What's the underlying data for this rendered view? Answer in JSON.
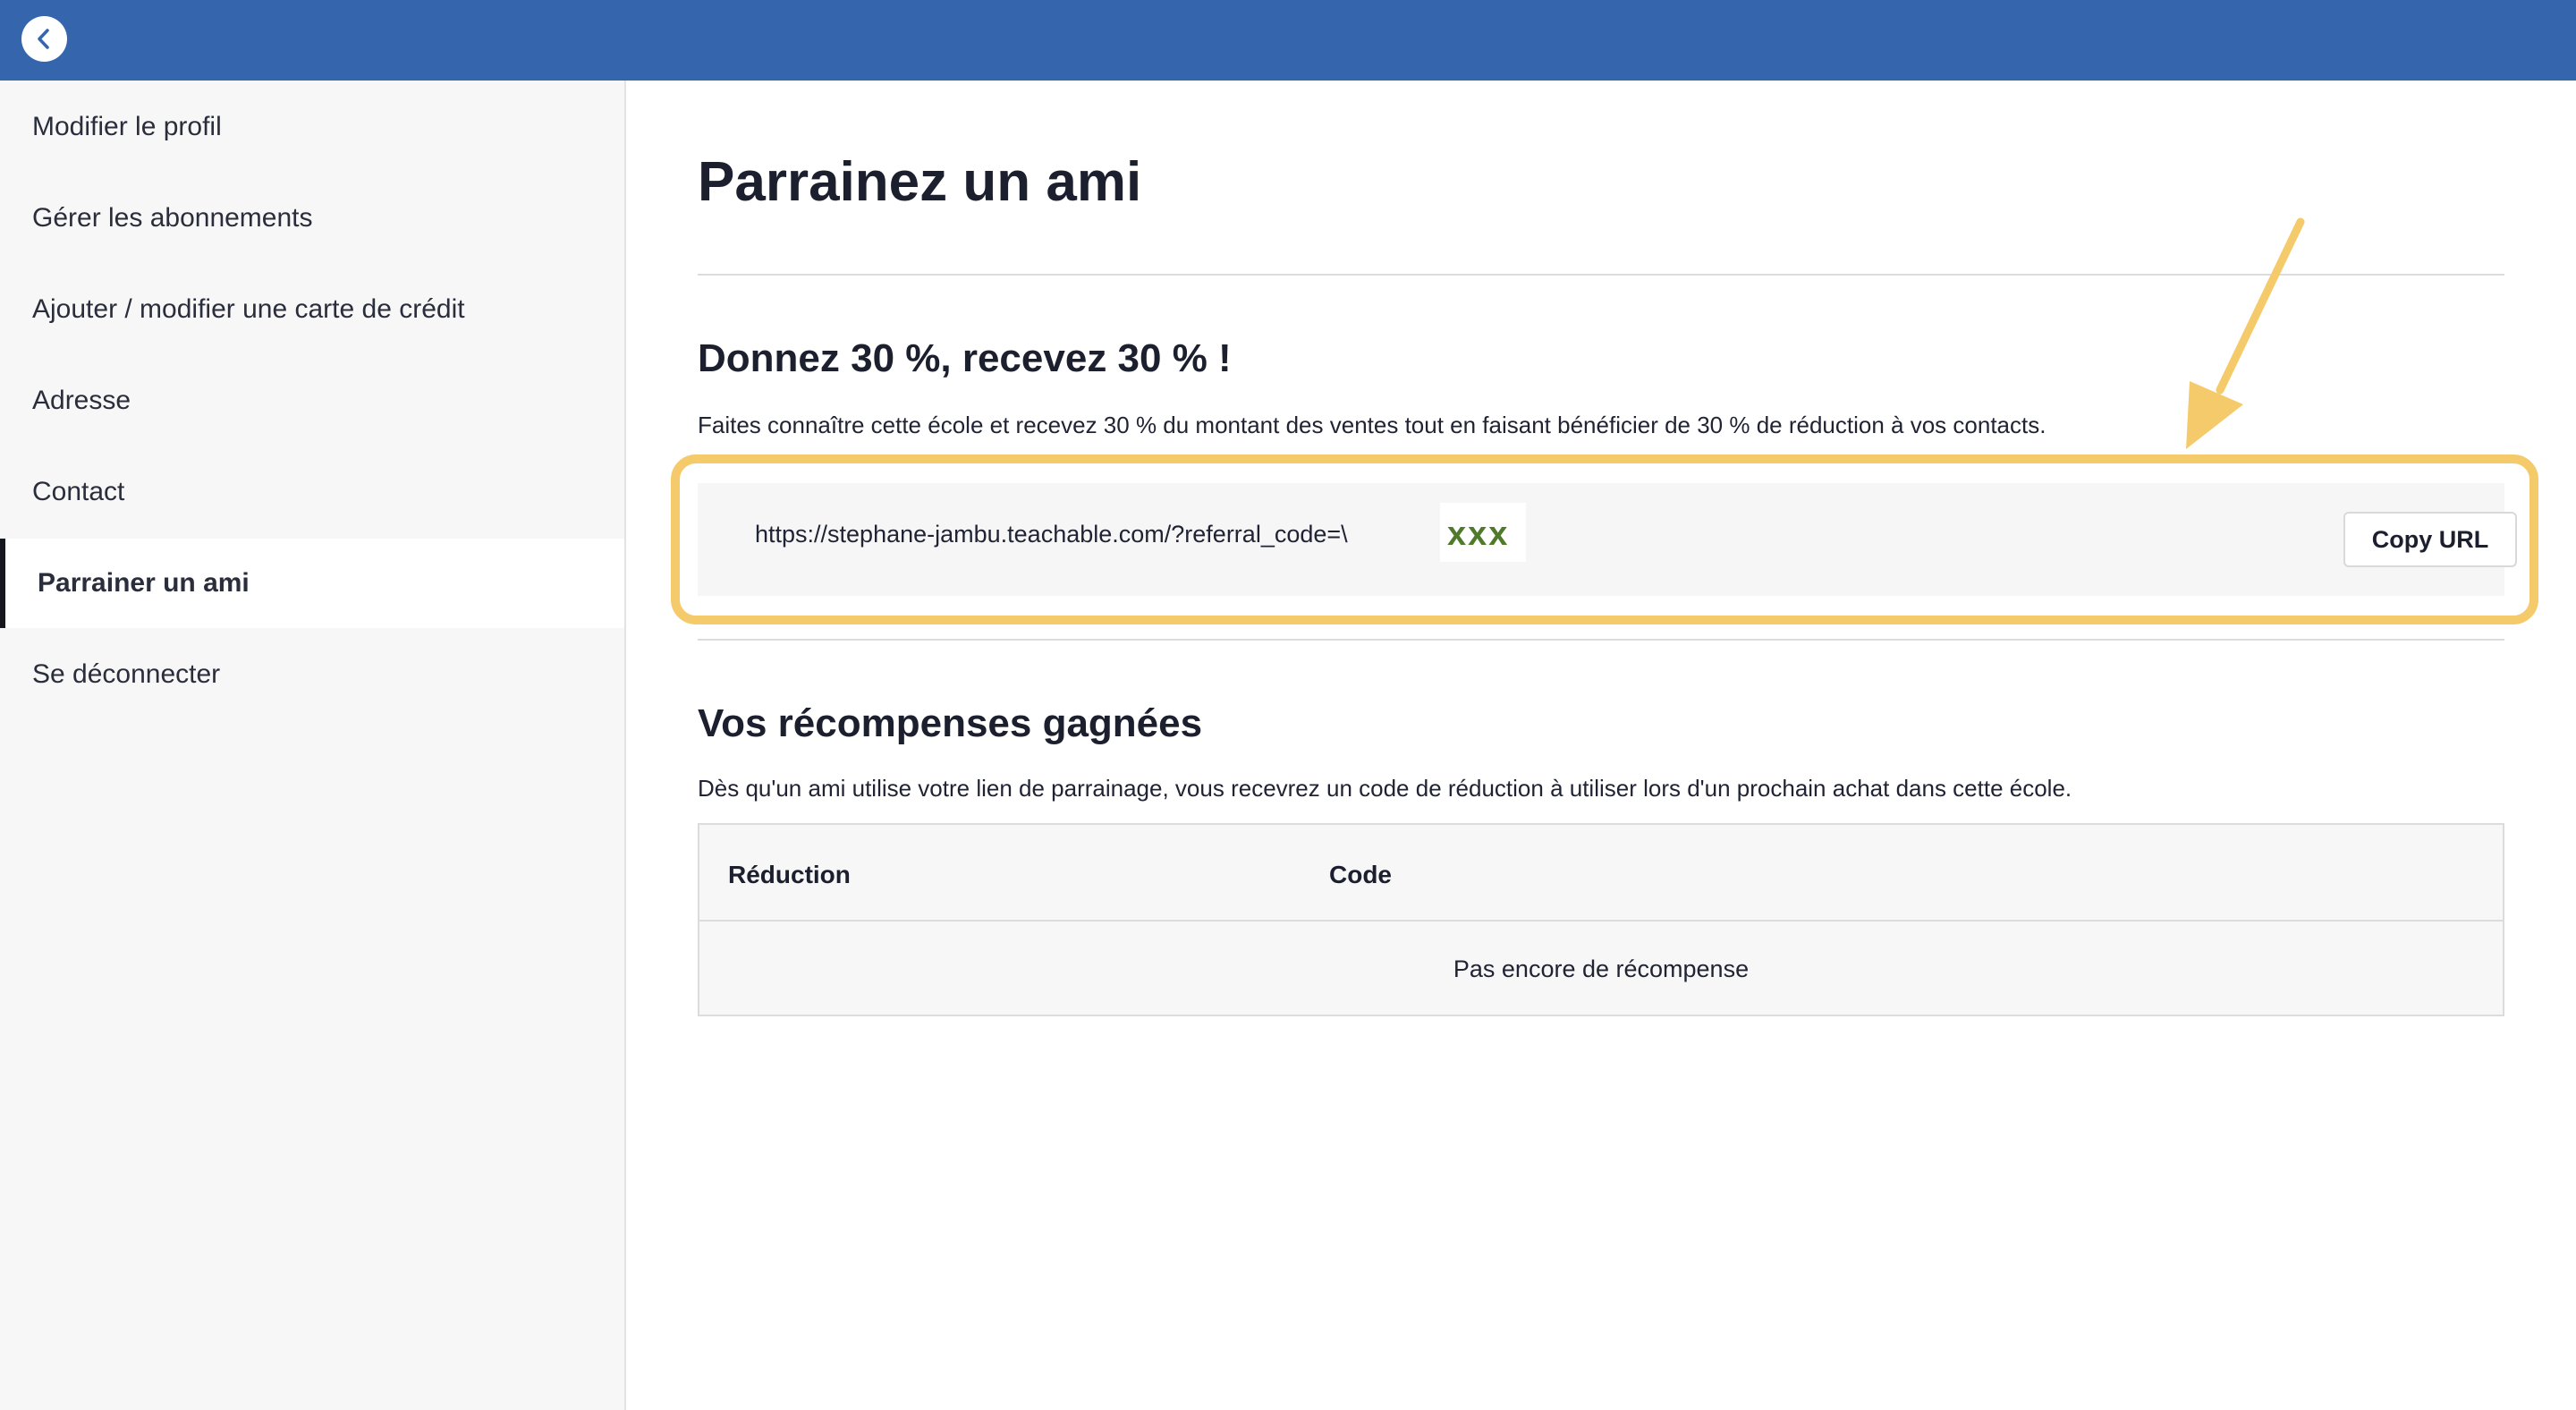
{
  "sidebar": {
    "items": [
      {
        "label": "Modifier le profil"
      },
      {
        "label": "Gérer les abonnements"
      },
      {
        "label": "Ajouter / modifier une carte de crédit"
      },
      {
        "label": "Adresse"
      },
      {
        "label": "Contact"
      },
      {
        "label": "Parrainer un ami",
        "active": true
      },
      {
        "label": "Se déconnecter"
      }
    ]
  },
  "topbar": {
    "back_icon": "chevron-left-icon",
    "color": "#3566ad"
  },
  "main": {
    "title": "Parrainez un ami",
    "referral": {
      "heading": "Donnez 30 %, recevez 30 % !",
      "description": "Faites connaître cette école et recevez 30 % du montant des ventes tout en faisant bénéficier de 30 % de réduction à vos contacts.",
      "url": "https://stephane-jambu.teachable.com/?referral_code=\\",
      "code_redacted": "xxx",
      "copy_label": "Copy URL"
    },
    "rewards": {
      "heading": "Vos récompenses gagnées",
      "description": "Dès qu'un ami utilise votre lien de parrainage, vous recevrez un code de réduction à utiliser lors d'un prochain achat dans cette école.",
      "columns": [
        "Réduction",
        "Code"
      ],
      "empty_message": "Pas encore de récompense"
    }
  },
  "annotation": {
    "color": "#f5ca6b"
  }
}
